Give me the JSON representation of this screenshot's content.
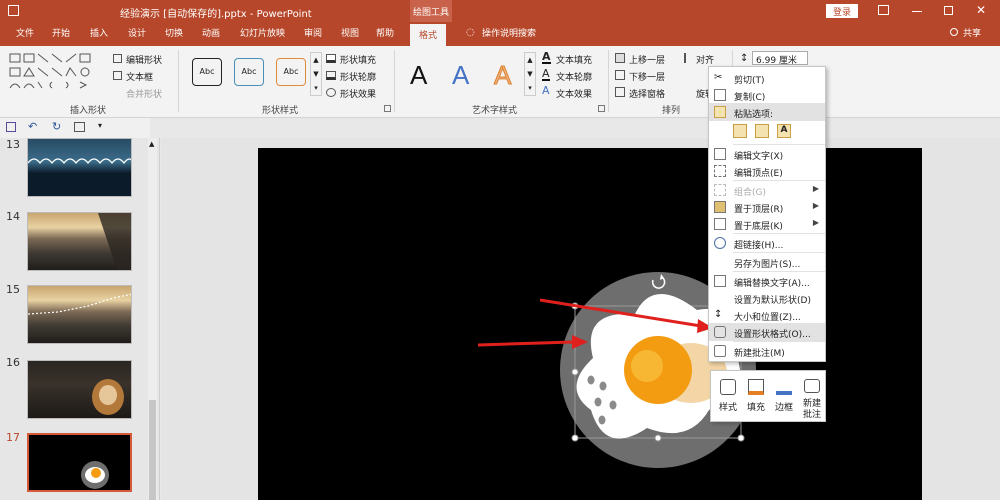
{
  "window": {
    "title": "经验演示 [自动保存的].pptx - PowerPoint",
    "drawing_tools": "绘图工具",
    "login": "登录",
    "share": "共享"
  },
  "tabs": [
    "文件",
    "开始",
    "插入",
    "设计",
    "切换",
    "动画",
    "幻灯片放映",
    "审阅",
    "视图",
    "帮助",
    "格式",
    "操作说明搜索"
  ],
  "ribbon": {
    "insert_shapes": {
      "label": "插入形状",
      "edit_shape": "编辑形状",
      "text_box": "文本框",
      "merge_shapes": "合并形状"
    },
    "shape_styles": {
      "label": "形状样式",
      "style_sample": "Abc",
      "fill": "形状填充",
      "outline": "形状轮廓",
      "effects": "形状效果"
    },
    "wordart": {
      "label": "艺术字样式",
      "sample": "A",
      "text_fill": "文本填充",
      "text_outline": "文本轮廓",
      "text_effects": "文本效果"
    },
    "arrange": {
      "label": "排列",
      "bring_forward": "上移一层",
      "send_backward": "下移一层",
      "selection_pane": "选择窗格",
      "align": "对齐",
      "rotate": "旋转"
    },
    "size": {
      "height": "6.99 厘米"
    }
  },
  "slides": [
    {
      "num": "13"
    },
    {
      "num": "14"
    },
    {
      "num": "15"
    },
    {
      "num": "16"
    },
    {
      "num": "17"
    }
  ],
  "context_menu": {
    "cut": "剪切(T)",
    "copy": "复制(C)",
    "paste_options": "粘贴选项:",
    "edit_text": "编辑文字(X)",
    "edit_points": "编辑顶点(E)",
    "group": "组合(G)",
    "bring_to_front": "置于顶层(R)",
    "send_to_back": "置于底层(K)",
    "hyperlink": "超链接(H)...",
    "save_as_picture": "另存为图片(S)...",
    "edit_alt_text": "编辑替换文字(A)...",
    "set_default": "设置为默认形状(D)",
    "size_position": "大小和位置(Z)...",
    "format_shape": "设置形状格式(O)...",
    "new_comment": "新建批注(M)"
  },
  "mini_toolbar": {
    "style": "样式",
    "fill": "填充",
    "outline": "边框",
    "new_comment": "新建批注"
  },
  "colors": {
    "accent": "#b7472a",
    "arrow": "#e0201c",
    "yolk": "#f39c12",
    "plate": "#6e6e6e"
  }
}
